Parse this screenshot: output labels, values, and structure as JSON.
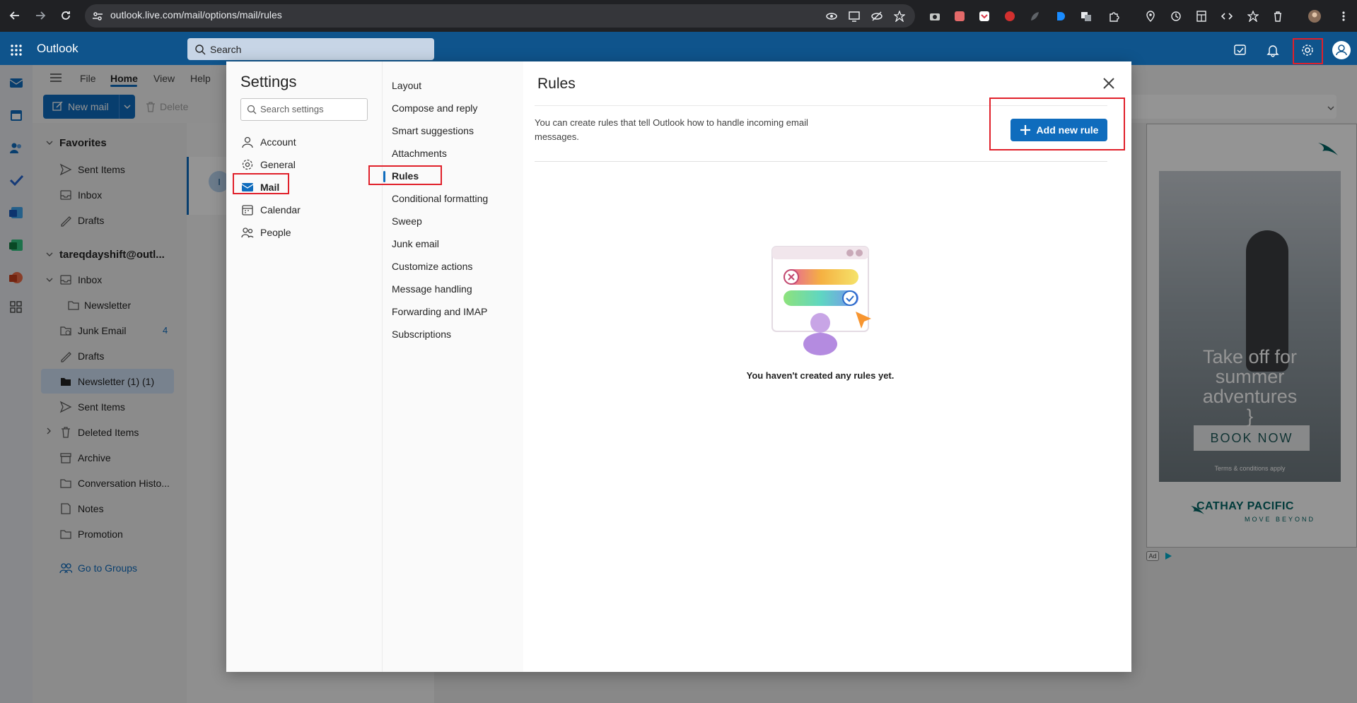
{
  "browser": {
    "url": "outlook.live.com/mail/options/mail/rules",
    "icons": [
      "back-icon",
      "forward-icon",
      "reload-icon",
      "site-settings-icon"
    ]
  },
  "app": {
    "title": "Outlook",
    "search_placeholder": "Search"
  },
  "ribbon": {
    "tabs": [
      "File",
      "Home",
      "View",
      "Help"
    ],
    "active_tab": "Home",
    "new_mail": "New mail",
    "delete": "Delete"
  },
  "folders": {
    "favorites_header": "Favorites",
    "favorites": [
      "Sent Items",
      "Inbox",
      "Drafts"
    ],
    "account_header": "tareqdayshift@outl...",
    "items": [
      {
        "label": "Inbox"
      },
      {
        "label": "Newsletter"
      },
      {
        "label": "Junk Email",
        "count": "4"
      },
      {
        "label": "Drafts"
      },
      {
        "label": "Newsletter (1) (1)"
      },
      {
        "label": "Sent Items"
      },
      {
        "label": "Deleted Items"
      },
      {
        "label": "Archive"
      },
      {
        "label": "Conversation Histo..."
      },
      {
        "label": "Notes"
      },
      {
        "label": "Promotion"
      }
    ],
    "groups_link": "Go to Groups"
  },
  "message_list": {
    "avatar_letter": "I"
  },
  "settings": {
    "title": "Settings",
    "search_placeholder": "Search settings",
    "categories": [
      "Account",
      "General",
      "Mail",
      "Calendar",
      "People"
    ],
    "selected_category": "Mail",
    "mail_subcategories": [
      "Layout",
      "Compose and reply",
      "Smart suggestions",
      "Attachments",
      "Rules",
      "Conditional formatting",
      "Sweep",
      "Junk email",
      "Customize actions",
      "Message handling",
      "Forwarding and IMAP",
      "Subscriptions"
    ],
    "selected_subcategory": "Rules"
  },
  "rules": {
    "title": "Rules",
    "description": "You can create rules that tell Outlook how to handle incoming email messages.",
    "add_button": "Add new rule",
    "empty_message": "You haven't created any rules yet."
  },
  "ad": {
    "headline_1": "Take off for",
    "headline_2": "summer",
    "headline_3": "adventures",
    "cta": "BOOK NOW",
    "terms": "Terms & conditions apply",
    "brand": "CATHAY PACIFIC",
    "tagline": "MOVE BEYOND",
    "badge": "Ad"
  },
  "colors": {
    "brand_blue": "#0f548c",
    "accent": "#0f6cbd",
    "highlight_red": "#e0202a"
  }
}
